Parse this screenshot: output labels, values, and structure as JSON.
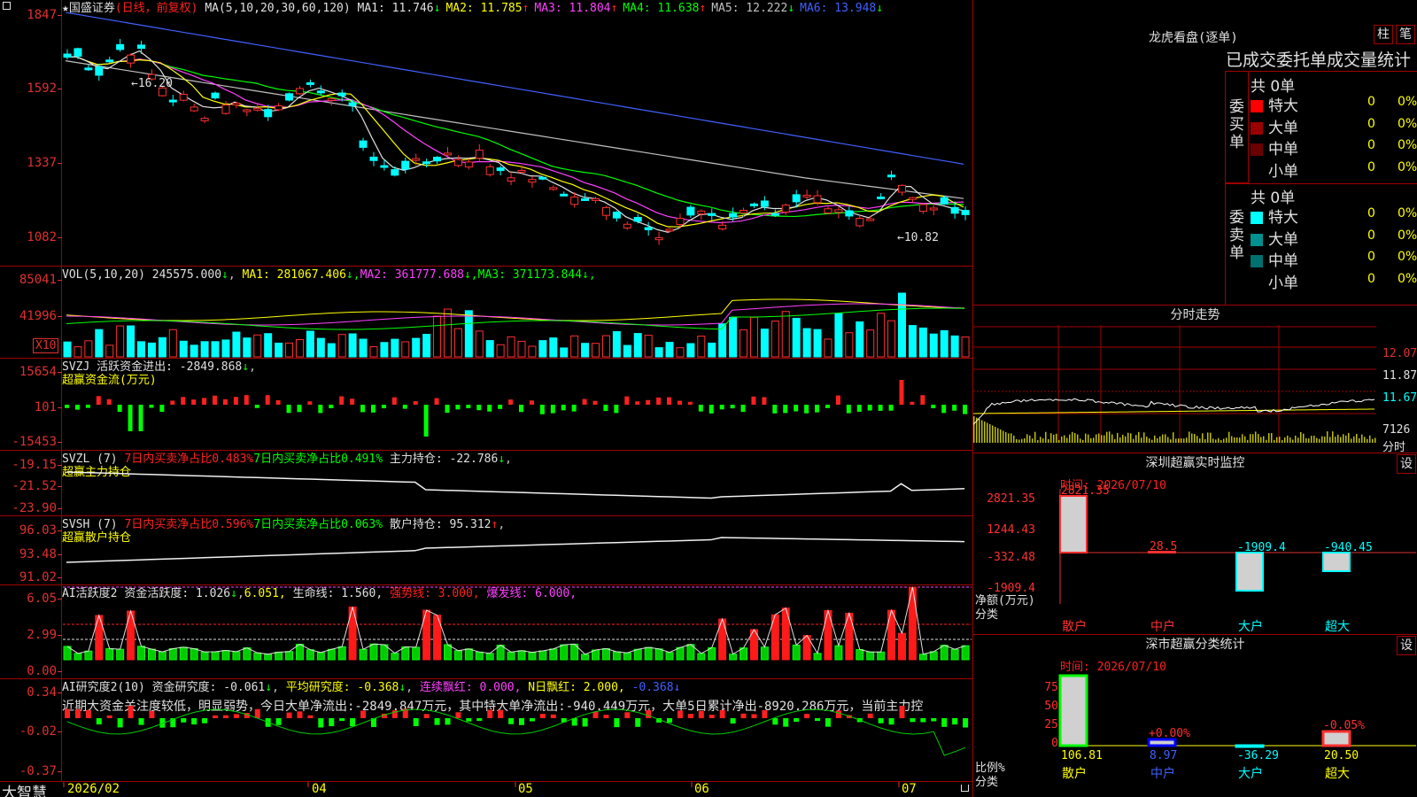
{
  "main": {
    "star": "★",
    "stock_name": "国盛证券",
    "period": "(日线，前复权)",
    "ma_label": "MA(5,10,20,30,60,120)",
    "ma": [
      {
        "name": "MA1:",
        "value": "11.746",
        "arrow": "↓",
        "color": "#e0e0e0"
      },
      {
        "name": "MA2:",
        "value": "11.785",
        "arrow": "↑",
        "color": "#ffff00"
      },
      {
        "name": "MA3:",
        "value": "11.804",
        "arrow": "↑",
        "color": "#ff40ff"
      },
      {
        "name": "MA4:",
        "value": "11.638",
        "arrow": "↑",
        "color": "#00ff00"
      },
      {
        "name": "MA5:",
        "value": "12.222",
        "arrow": "↓",
        "color": "#c0c0c0"
      },
      {
        "name": "MA6:",
        "value": "13.948",
        "arrow": "↓",
        "color": "#4060ff"
      }
    ],
    "y_ticks": [
      "1847",
      "1592",
      "1337",
      "1082"
    ],
    "high_label": "←16.20",
    "low_label": "←10.82"
  },
  "vol": {
    "label": "VOL(5,10,20)",
    "value": "245575.000",
    "ma": [
      {
        "name": "MA1:",
        "value": "281067.406",
        "color": "#ffff00"
      },
      {
        "name": "MA2:",
        "value": "361777.688",
        "color": "#ff40ff"
      },
      {
        "name": "MA3:",
        "value": "371173.844",
        "color": "#00ff00"
      }
    ],
    "y_ticks": [
      "85041",
      "41996"
    ],
    "unit": "X10"
  },
  "svzj": {
    "name": "SVZJ",
    "label": "活跃资金进出:",
    "value": "-2849.868",
    "subtitle": "超赢资金流(万元)",
    "y_ticks": [
      "15654",
      "101",
      "-15453"
    ]
  },
  "svzl": {
    "name": "SVZL (7)",
    "t1": "7日内买卖净占比0.483%",
    "t2": "7日内买卖净占比0.491%",
    "t3": "主力持仓: -22.786",
    "subtitle": "超赢主力持仓",
    "y_ticks": [
      "-19.15",
      "-21.52",
      "-23.90"
    ]
  },
  "svsh": {
    "name": "SVSH (7)",
    "t1": "7日内买卖净占比0.596%",
    "t2": "7日内买卖净占比0.063%",
    "t3": "散户持仓: 95.312",
    "subtitle": "超赢散户持仓",
    "y_ticks": [
      "96.03",
      "93.48",
      "91.02"
    ]
  },
  "ai1": {
    "name": "AI活跃度2",
    "t1": "资金活跃度: 1.026",
    "t2": "6.051,",
    "t3": "生命线: 1.560,",
    "t4": "强势线: 3.000,",
    "t5": "爆发线: 6.000,",
    "y_ticks": [
      "6.05",
      "2.99",
      "0.00"
    ]
  },
  "ai2": {
    "name": "AI研究度2(10)",
    "t1": "资金研究度: -0.061",
    "t2": "平均研究度: -0.368",
    "t3": "连续飘红: 0.000,",
    "t4": "N日飘红: 2.000,",
    "t5": "-0.368",
    "comment": "近期大资金关注度较低，明显弱势，今日大单净流出:-2849.847万元，其中特大单净流出:-940.449万元，大单5日累计净出-8920.286万元，当前主力控",
    "y_ticks": [
      "0.34",
      "-0.02",
      "-0.37"
    ]
  },
  "xaxis": {
    "brand": "大智慧",
    "labels": [
      "2026/02",
      "04",
      "05",
      "06",
      "07"
    ]
  },
  "longhu": {
    "title": "龙虎看盘(逐单)",
    "btn1": "柱",
    "btn2": "笔",
    "subtitle": "已成交委托单成交量统计",
    "buy_label": "委买单",
    "sell_label": "委卖单",
    "buy_total": "共 0单",
    "sell_total": "共 0单",
    "buy_rows": [
      {
        "label": "特大",
        "count": "0",
        "pct": "0%",
        "color": "#ff0000"
      },
      {
        "label": "大单",
        "count": "0",
        "pct": "0%",
        "color": "#9a0000"
      },
      {
        "label": "中单",
        "count": "0",
        "pct": "0%",
        "color": "#6a0000"
      },
      {
        "label": "小单",
        "count": "0",
        "pct": "0%",
        "color": "#000000"
      }
    ],
    "sell_rows": [
      {
        "label": "特大",
        "count": "0",
        "pct": "0%",
        "color": "#00ffff"
      },
      {
        "label": "大单",
        "count": "0",
        "pct": "0%",
        "color": "#009090"
      },
      {
        "label": "中单",
        "count": "0",
        "pct": "0%",
        "color": "#007070"
      },
      {
        "label": "小单",
        "count": "0",
        "pct": "0%",
        "color": "#000000"
      }
    ]
  },
  "fenshi": {
    "title": "分时走势",
    "prices": [
      "12.07",
      "11.87",
      "11.67"
    ],
    "vol": "7126",
    "unit": "分时"
  },
  "monitor": {
    "title": "深圳超赢实时监控",
    "set": "设",
    "time": "时间: 2026/07/10",
    "y_ticks": [
      "2821.35",
      "1244.43",
      "-332.48",
      "-1909.4"
    ],
    "bar_labels": [
      "2821.35",
      "28.5",
      "-1909.4",
      "-940.45"
    ],
    "axis_name1": "净额(万元)",
    "axis_name2": "分类",
    "categories": [
      "散户",
      "中户",
      "大户",
      "超大"
    ]
  },
  "classify": {
    "title": "深市超赢分类统计",
    "set": "设",
    "time": "时间: 2026/07/10",
    "y_ticks": [
      "75",
      "50",
      "25",
      "0"
    ],
    "bar_top": [
      "",
      "+0.00%",
      "",
      "-0.05%"
    ],
    "bar_bottom": [
      "106.81",
      "8.97",
      "-36.29",
      "20.50"
    ],
    "axis_name1": "比例%",
    "axis_name2": "分类",
    "categories": [
      "散户",
      "中户",
      "大户",
      "超大"
    ]
  }
}
